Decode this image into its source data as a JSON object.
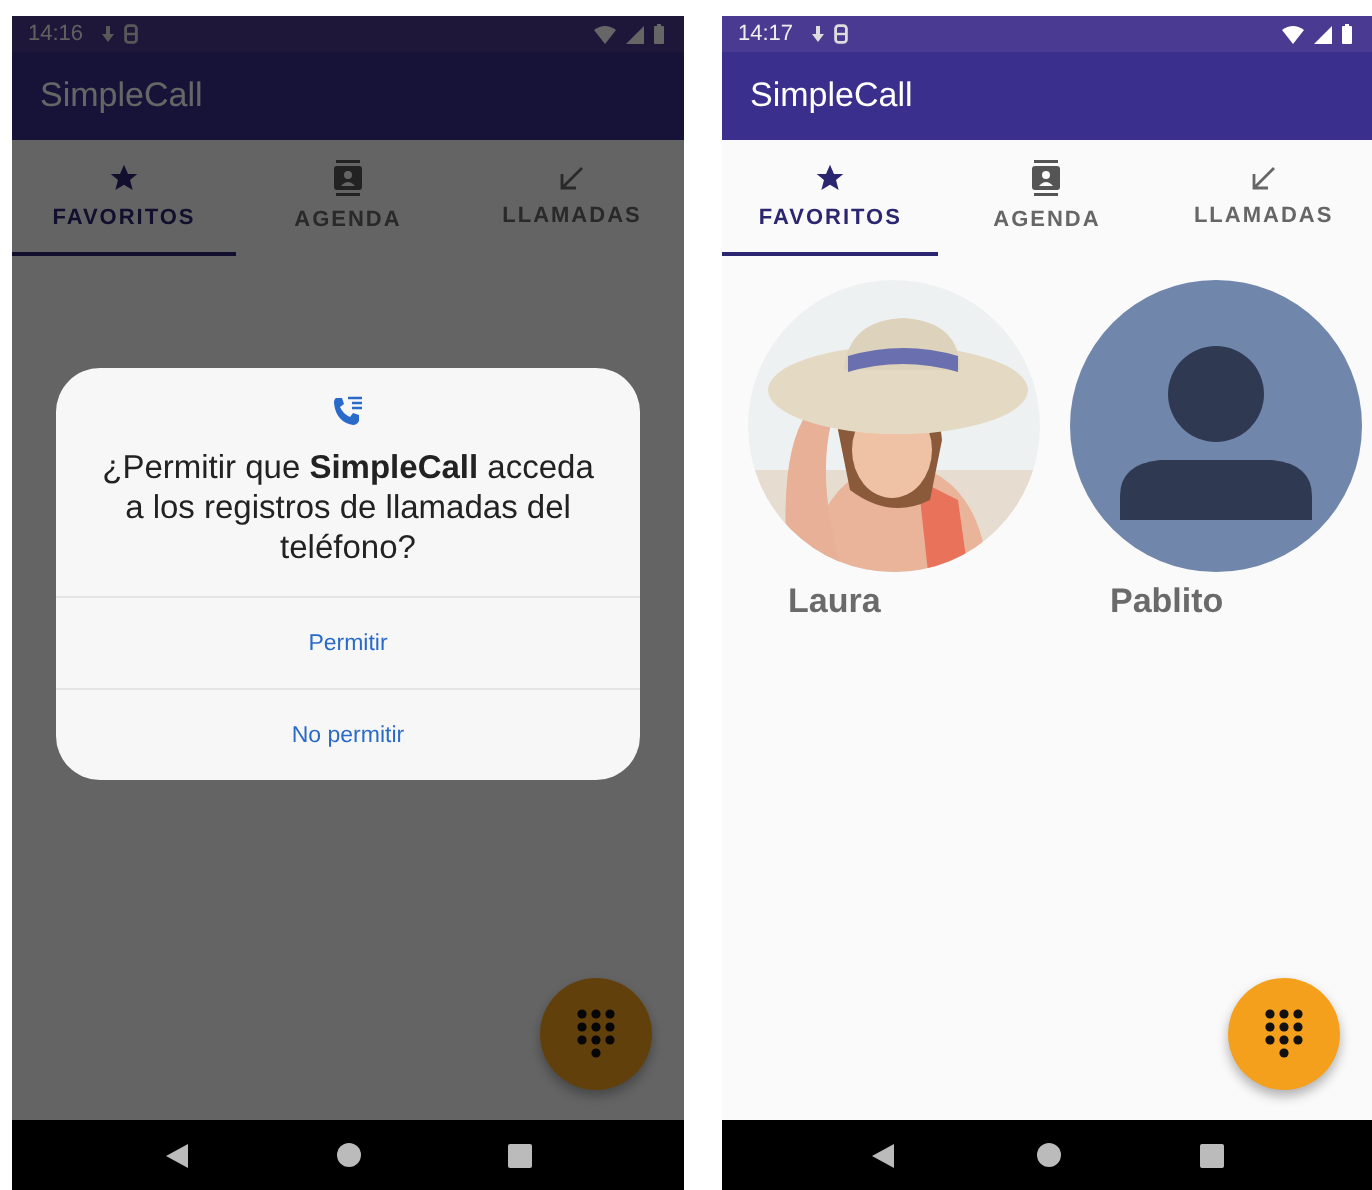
{
  "phones": [
    {
      "status": {
        "time": "14:16"
      },
      "app_title": "SimpleCall",
      "dimmed": true,
      "tabs": [
        {
          "label": "FAVORITOS",
          "kind": "star",
          "selected": true
        },
        {
          "label": "AGENDA",
          "kind": "contacts",
          "selected": false
        },
        {
          "label": "LLAMADAS",
          "kind": "calls",
          "selected": false
        }
      ],
      "dialog": {
        "text": "¿Permitir que **SimpleCall** acceda a los registros de llamadas del teléfono?",
        "buttons": [
          "Permitir",
          "No permitir"
        ]
      }
    },
    {
      "status": {
        "time": "14:17"
      },
      "app_title": "SimpleCall",
      "dimmed": false,
      "tabs": [
        {
          "label": "FAVORITOS",
          "kind": "star",
          "selected": true
        },
        {
          "label": "AGENDA",
          "kind": "contacts",
          "selected": false
        },
        {
          "label": "LLAMADAS",
          "kind": "calls",
          "selected": false
        }
      ],
      "contacts": [
        {
          "name": "Laura"
        },
        {
          "name": "Pablito",
          "kind": "placeholder"
        }
      ]
    }
  ]
}
